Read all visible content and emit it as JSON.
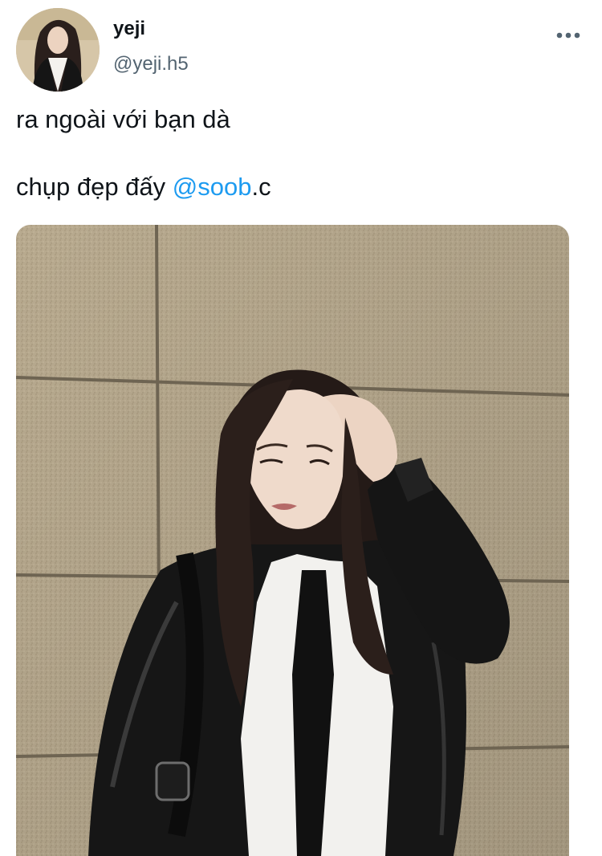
{
  "author": {
    "display_name": "yeji",
    "handle": "@yeji.h5",
    "avatar_icon": "profile-photo"
  },
  "more_icon": "more-horizontal-icon",
  "tweet": {
    "line1": "ra ngoài với bạn dà",
    "line2_prefix": "chụp đẹp đấy ",
    "mention": "@soob",
    "line2_suffix": ".c"
  },
  "media": {
    "alt": "photo-of-woman-in-black-leather-jacket-against-stone-wall"
  },
  "colors": {
    "link": "#1d9bf0",
    "secondary_text": "#536471",
    "primary_text": "#0f1419"
  }
}
